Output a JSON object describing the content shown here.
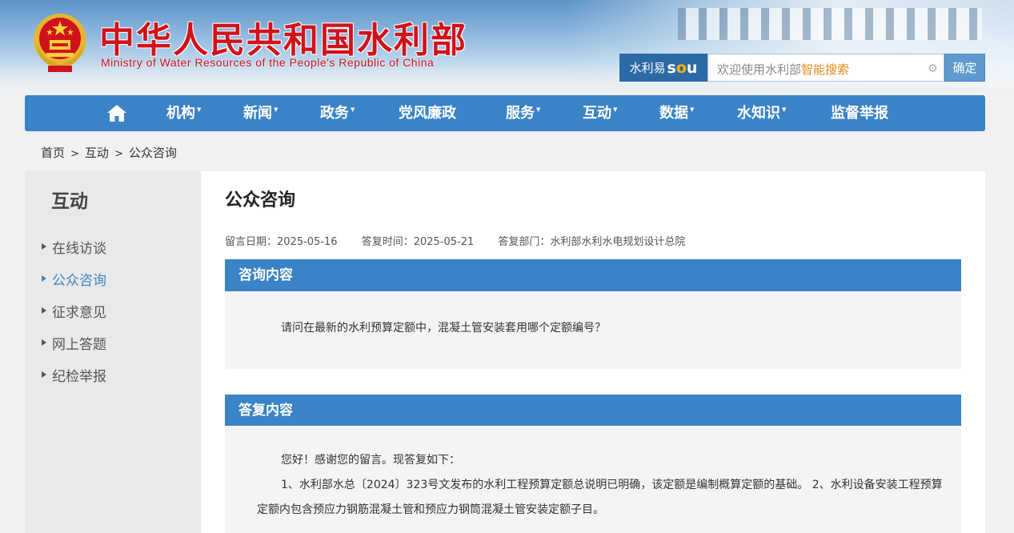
{
  "header": {
    "title": "中华人民共和国水利部",
    "subtitle": "Ministry of Water Resources of the People's Republic of China",
    "search": {
      "brand_prefix": "水利易",
      "brand_suffix_s": "s",
      "brand_suffix_o": "o",
      "brand_suffix_u": "u",
      "placeholder_main": "欢迎使用水利部",
      "placeholder_highlight": "智能搜索",
      "submit_label": "确定"
    }
  },
  "nav": {
    "items": [
      {
        "label": "机构",
        "has_dropdown": true
      },
      {
        "label": "新闻",
        "has_dropdown": true
      },
      {
        "label": "政务",
        "has_dropdown": true
      },
      {
        "label": "党风廉政",
        "has_dropdown": false
      },
      {
        "label": "服务",
        "has_dropdown": true
      },
      {
        "label": "互动",
        "has_dropdown": true
      },
      {
        "label": "数据",
        "has_dropdown": true
      },
      {
        "label": "水知识",
        "has_dropdown": true
      },
      {
        "label": "监督举报",
        "has_dropdown": false
      }
    ],
    "caret": "▼"
  },
  "breadcrumb": {
    "items": [
      "首页",
      "互动",
      "公众咨询"
    ],
    "separator": ">"
  },
  "sidebar": {
    "heading": "互动",
    "items": [
      {
        "label": "在线访谈",
        "active": false
      },
      {
        "label": "公众咨询",
        "active": true
      },
      {
        "label": "征求意见",
        "active": false
      },
      {
        "label": "网上答题",
        "active": false
      },
      {
        "label": "纪检举报",
        "active": false
      }
    ]
  },
  "main": {
    "title": "公众咨询",
    "meta": {
      "post_date": "留言日期：2025-05-16",
      "reply_date": "答复时间：2025-05-21",
      "reply_dept": "答复部门：水利部水利水电规划设计总院"
    },
    "question": {
      "heading": "咨询内容",
      "text": "请问在最新的水利预算定额中，混凝土管安装套用哪个定额编号？"
    },
    "answer": {
      "heading": "答复内容",
      "greeting": "您好！感谢您的留言。现答复如下：",
      "body": "1、水利部水总〔2024〕323号文发布的水利工程预算定额总说明已明确，该定额是编制概算定额的基础。 2、水利设备安装工程预算定额内包含预应力钢筋混凝土管和预应力钢筒混凝土管安装定额子目。"
    }
  },
  "colors": {
    "primary_blue": "#3a83c7",
    "title_red": "#d0121b",
    "search_brand": "#2c6aa7",
    "highlight_orange": "#e08b1a"
  }
}
